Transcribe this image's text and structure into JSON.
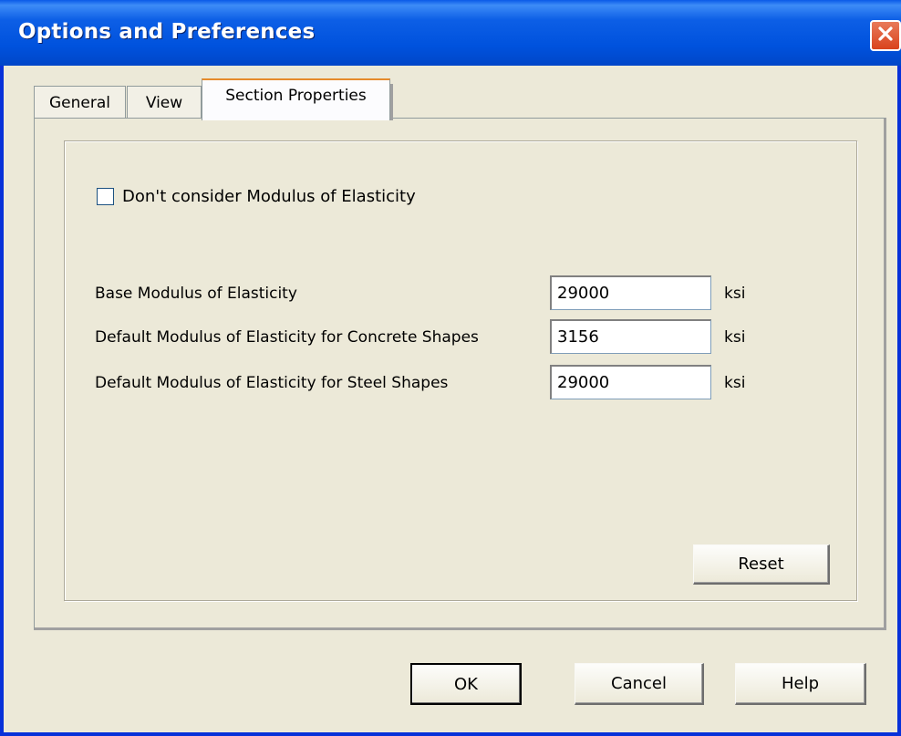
{
  "window": {
    "title": "Options and Preferences"
  },
  "tabs": [
    {
      "label": "General",
      "active": false
    },
    {
      "label": "View",
      "active": false
    },
    {
      "label": "Section Properties",
      "active": true
    }
  ],
  "section_properties": {
    "checkbox": {
      "label": "Don't consider Modulus of Elasticity",
      "checked": false
    },
    "fields": [
      {
        "label": "Base Modulus of Elasticity",
        "value": "29000",
        "unit": "ksi"
      },
      {
        "label": "Default Modulus of Elasticity for Concrete Shapes",
        "value": "3156",
        "unit": "ksi"
      },
      {
        "label": "Default Modulus of Elasticity for Steel Shapes",
        "value": "29000",
        "unit": "ksi"
      }
    ],
    "reset_label": "Reset"
  },
  "buttons": {
    "ok": "OK",
    "cancel": "Cancel",
    "help": "Help"
  },
  "icons": {
    "close": "close-icon"
  }
}
